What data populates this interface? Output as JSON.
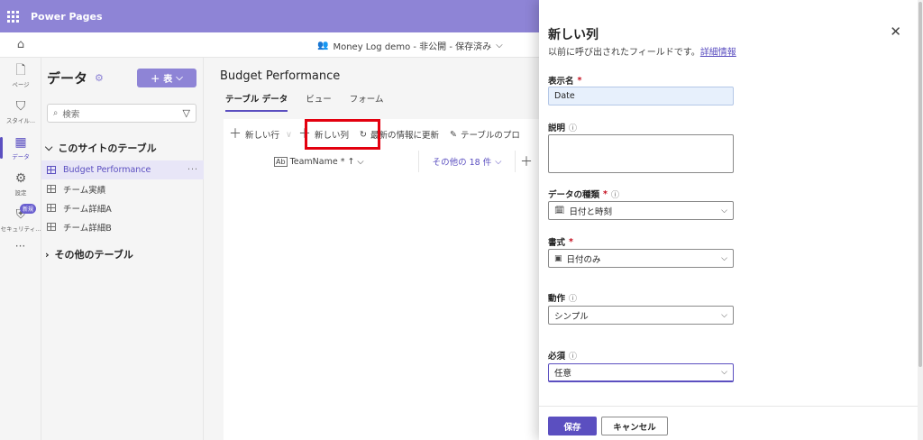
{
  "topbar": {
    "app_title": "Power Pages"
  },
  "subbar": {
    "site_status": "Money Log demo - 非公開 - 保存済み"
  },
  "rail": {
    "items": [
      {
        "label": "ページ",
        "icon": "page-icon"
      },
      {
        "label": "スタイル...",
        "icon": "brush-icon"
      },
      {
        "label": "データ",
        "icon": "data-table-icon"
      },
      {
        "label": "設定",
        "icon": "settings-icon"
      },
      {
        "label": "セキュリティ...",
        "icon": "shield-icon",
        "badge": "新規"
      }
    ],
    "more": "···"
  },
  "data_panel": {
    "title": "データ",
    "add_button": "表",
    "search_placeholder": "検索",
    "this_site_section": "このサイトのテーブル",
    "tables": [
      {
        "name": "Budget Performance",
        "selected": true
      },
      {
        "name": "チーム実績"
      },
      {
        "name": "チーム詳細A"
      },
      {
        "name": "チーム詳細B"
      }
    ],
    "other_section": "その他のテーブル"
  },
  "main": {
    "title": "Budget Performance",
    "tabs": [
      "テーブル データ",
      "ビュー",
      "フォーム"
    ],
    "commands": {
      "new_row": "新しい行",
      "new_column": "新しい列",
      "refresh": "最新の情報に更新",
      "table_props": "テーブルのプロ"
    },
    "columns": {
      "teamname": "TeamName",
      "others": "その他の 18 件"
    }
  },
  "panel": {
    "title": "新しい列",
    "subtitle": "以前に呼び出されたフィールドです。",
    "learn_more": "詳細情報",
    "display_name_label": "表示名",
    "display_name_value": "Date",
    "description_label": "説明",
    "data_type_label": "データの種類",
    "data_type_value": "日付と時刻",
    "format_label": "書式",
    "format_value": "日付のみ",
    "behavior_label": "動作",
    "behavior_value": "シンプル",
    "required_label": "必須",
    "required_value": "任意",
    "save": "保存",
    "cancel": "キャンセル"
  },
  "colors": {
    "brand": "#8e84d6",
    "accent": "#5b4fc0",
    "highlight": "#e3000f"
  }
}
